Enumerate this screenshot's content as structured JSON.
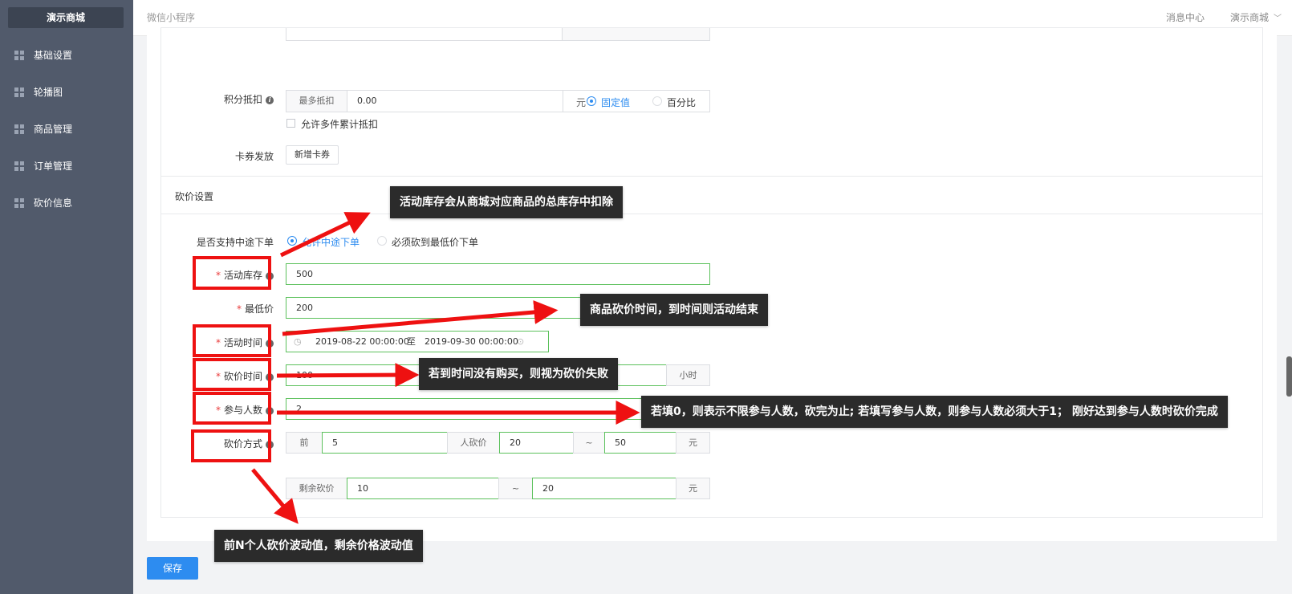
{
  "sidebar": {
    "brand": "演示商城",
    "items": [
      {
        "label": "基础设置",
        "icon": "grid-icon"
      },
      {
        "label": "轮播图",
        "icon": "grid-icon"
      },
      {
        "label": "商品管理",
        "icon": "grid-icon"
      },
      {
        "label": "订单管理",
        "icon": "grid-icon"
      },
      {
        "label": "砍价信息",
        "icon": "grid-icon"
      }
    ]
  },
  "header": {
    "title": "微信小程序",
    "messages": "消息中心",
    "shop_menu": "演示商城"
  },
  "points": {
    "label": "积分抵扣",
    "prefix": "最多抵扣",
    "value": "0.00",
    "unit": "元",
    "opt_fixed": "固定值",
    "opt_percent": "百分比",
    "selected": "固定值",
    "stack_checkbox": "允许多件累计抵扣",
    "stack_checked": false
  },
  "coupon": {
    "label": "卡券发放",
    "add_button": "新增卡券"
  },
  "bargain": {
    "section_title": "砍价设置",
    "midway": {
      "label": "是否支持中途下单",
      "opt_allow": "允许中途下单",
      "opt_must": "必须砍到最低价下单",
      "selected": "允许中途下单"
    },
    "stock": {
      "label": "活动库存",
      "value": "500"
    },
    "min_price": {
      "label": "最低价",
      "value": "200"
    },
    "time": {
      "label": "活动时间",
      "start": "2019-08-22 00:00:00",
      "separator": "至",
      "end": "2019-09-30 00:00:00"
    },
    "duration": {
      "label": "砍价时间",
      "value": "100",
      "unit": "小时"
    },
    "people": {
      "label": "参与人数",
      "value": "2"
    },
    "method": {
      "label": "砍价方式",
      "prefix": "前",
      "first_n": "5",
      "per_person": "人砍价",
      "min": "20",
      "tilde": "~",
      "max": "50",
      "unit": "元"
    },
    "remaining": {
      "prefix": "剩余砍价",
      "min": "10",
      "tilde": "~",
      "max": "20",
      "unit": "元"
    }
  },
  "save_button": "保存",
  "annotations": {
    "stock_note": "活动库存会从商城对应商品的总库存中扣除",
    "time_note": "商品砍价时间，到时间则活动结束",
    "duration_note": "若到时间没有购买，则视为砍价失败",
    "people_note": "若填0，则表示不限参与人数，砍完为止; 若填写参与人数，则参与人数必须大于1； 刚好达到参与人数时砍价完成",
    "method_note": "前N个人砍价波动值，剩余价格波动值"
  },
  "colors": {
    "sidebar_bg": "#515a6b",
    "accent": "#2d8cf0",
    "valid_border": "#5cc15c",
    "annotation_red": "#ee1111",
    "callout_bg": "#2b2b2b"
  }
}
